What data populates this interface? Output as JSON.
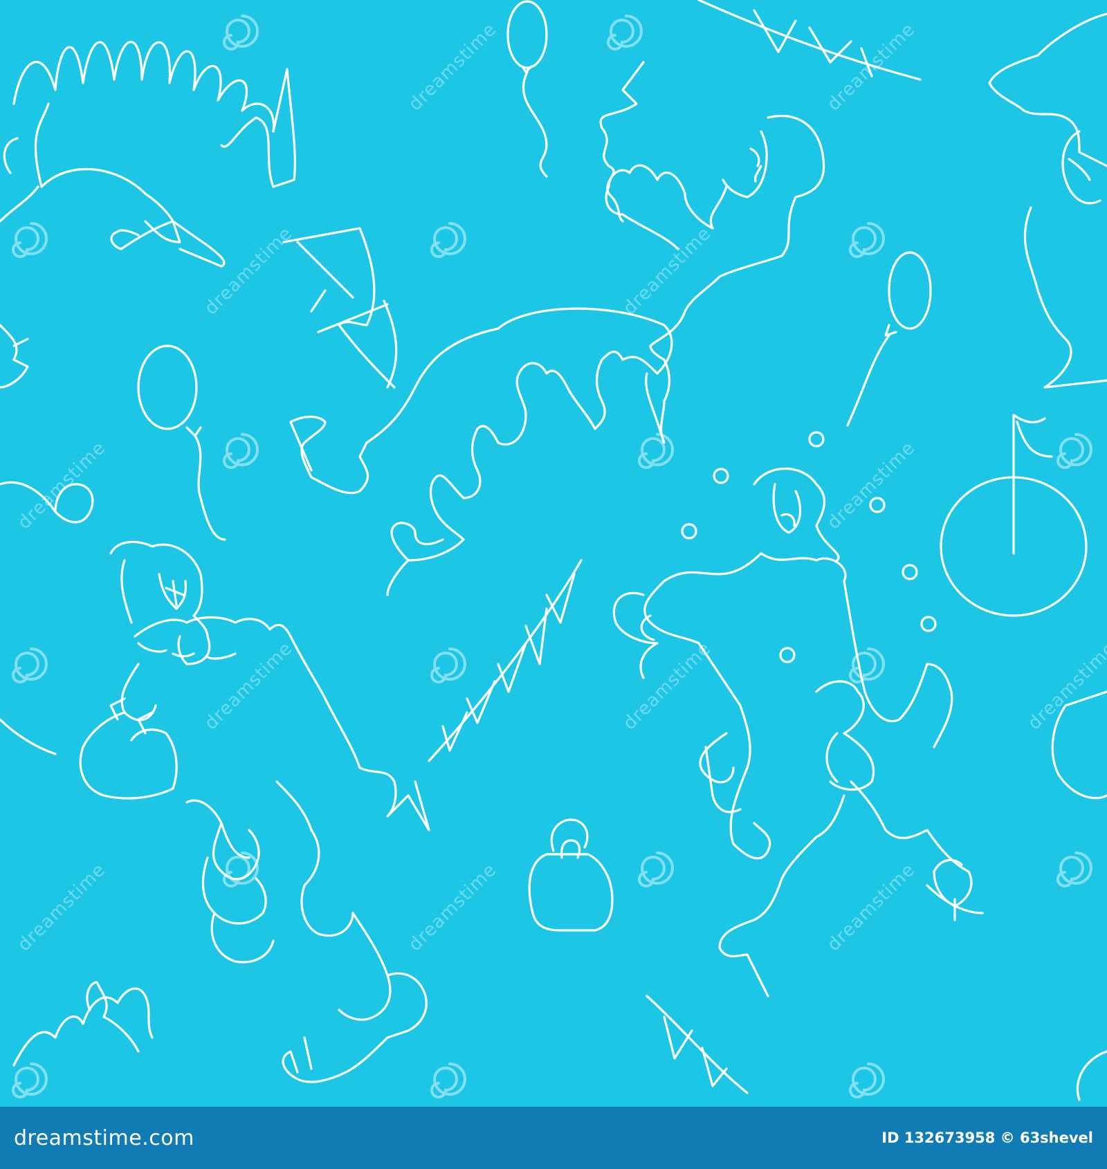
{
  "image": {
    "background_color": "#1ec6e6",
    "line_color": "#ffffff",
    "subject_icons": [
      "clown-figure",
      "balloon",
      "bunting-flags",
      "kettlebell",
      "bicycle-wheel",
      "juggling-balls"
    ]
  },
  "watermark": {
    "text": "dreamstime",
    "icon": "swirl-logo-icon"
  },
  "footer": {
    "brand": "dreamstime.com",
    "id_label": "ID 132673958",
    "copyright": "© 63shevel",
    "background_color": "#117bb3"
  }
}
